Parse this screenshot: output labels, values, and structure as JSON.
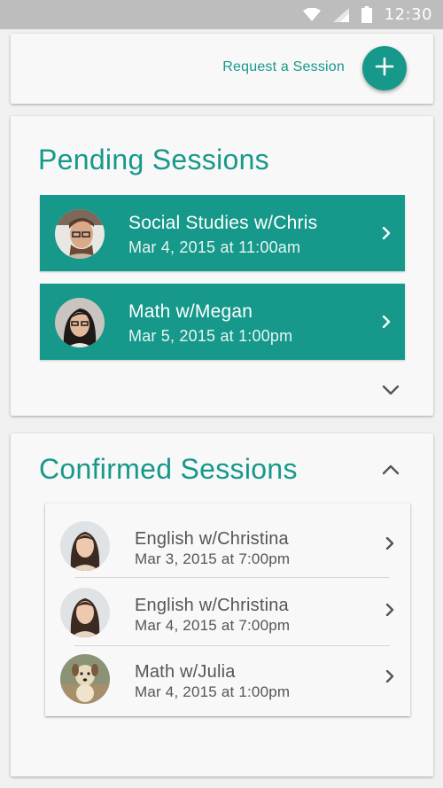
{
  "status_bar": {
    "time": "12:30",
    "icons": [
      "wifi-icon",
      "cell-signal-icon",
      "battery-icon"
    ]
  },
  "top": {
    "request_label": "Request a Session",
    "fab_icon": "plus-icon"
  },
  "pending": {
    "title": "Pending Sessions",
    "items": [
      {
        "title": "Social Studies w/Chris",
        "date": "Mar 4, 2015 at 11:00am"
      },
      {
        "title": "Math w/Megan",
        "date": "Mar 5, 2015 at 1:00pm"
      }
    ],
    "toggle_icon": "chevron-down-icon"
  },
  "confirmed": {
    "title": "Confirmed Sessions",
    "toggle_icon": "chevron-up-icon",
    "items": [
      {
        "title": "English w/Christina",
        "date": "Mar 3, 2015 at 7:00pm"
      },
      {
        "title": "English w/Christina",
        "date": "Mar 4, 2015 at 7:00pm"
      },
      {
        "title": "Math w/Julia",
        "date": "Mar 4, 2015 at 1:00pm"
      }
    ]
  },
  "colors": {
    "accent": "#16998a",
    "status_bar": "#bdbdbd",
    "background": "#f0f0f0",
    "card": "#f8f8f8"
  }
}
